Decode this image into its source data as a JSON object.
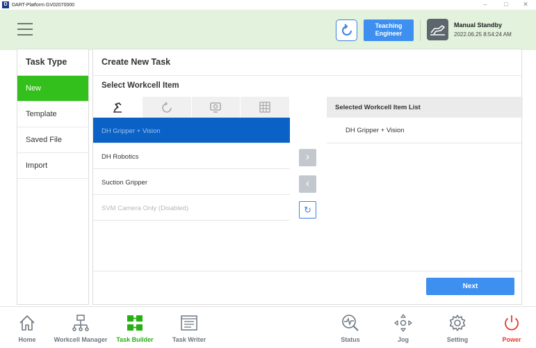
{
  "window": {
    "title": "DART-Platform GV02070000",
    "app_icon": "D",
    "minimize": "–",
    "maximize": "□",
    "close": "✕"
  },
  "header": {
    "mode_button": "Teaching Engineer",
    "status_title": "Manual Standby",
    "status_time": "2022.06.25 8:54:24 AM",
    "refresh_icon": "⥁"
  },
  "side": {
    "title": "Task Type",
    "items": [
      "New",
      "Template",
      "Saved File",
      "Import"
    ]
  },
  "main": {
    "title": "Create New Task",
    "section_title": "Select Workcell Item",
    "tabs": [
      "robot-arm-icon",
      "gripper-icon",
      "camera-icon",
      "grid-icon"
    ],
    "items": [
      "DH Gripper + Vision",
      "DH Robotics",
      "Suction Gripper",
      "SVM Camera Only (Disabled)"
    ],
    "move_right": "›",
    "move_left": "‹",
    "reset": "↻",
    "selected_header": "Selected Workcell Item List",
    "selected_items": [
      "DH Gripper + Vision"
    ],
    "next_button": "Next"
  },
  "nav": {
    "items": [
      "Home",
      "Workcell Manager",
      "Task Builder",
      "Task Writer",
      "Status",
      "Jog",
      "Setting",
      "Power"
    ]
  },
  "colors": {
    "accent_blue": "#3d8ff0",
    "selection_blue": "#0a62c7",
    "active_green": "#34c01c",
    "header_bg": "#e2f2dc",
    "power_red": "#e8362e"
  }
}
